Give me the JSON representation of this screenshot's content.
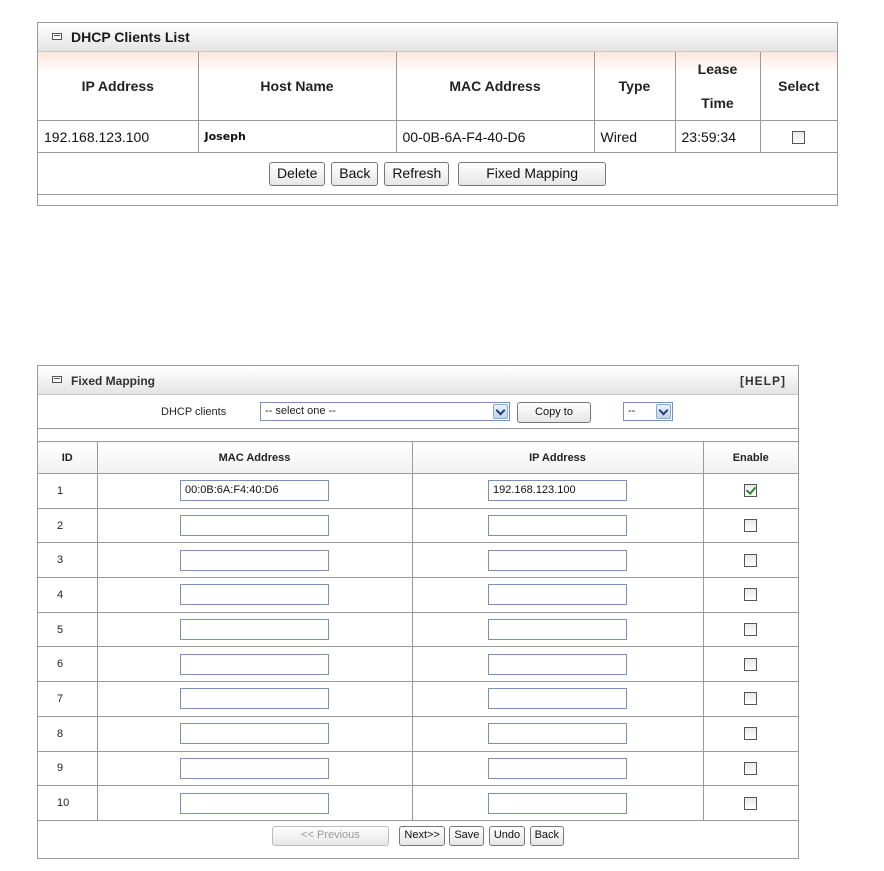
{
  "clients_panel": {
    "title": "DHCP Clients List",
    "columns": [
      "IP Address",
      "Host Name",
      "MAC Address",
      "Type",
      "Lease",
      "Time",
      "Select"
    ],
    "rows": [
      {
        "ip": "192.168.123.100",
        "host": "Joseph",
        "mac": "00-0B-6A-F4-40-D6",
        "type": "Wired",
        "lease": "23:59:34",
        "selected": false
      }
    ],
    "buttons": {
      "delete": "Delete",
      "back": "Back",
      "refresh": "Refresh",
      "fixed_mapping": "Fixed Mapping"
    }
  },
  "mapping_panel": {
    "title": "Fixed Mapping",
    "help": "[HELP]",
    "dhcp_clients_label": "DHCP clients",
    "dhcp_clients_select": "-- select one --",
    "copy_to_button": "Copy to",
    "copy_target_select": "--",
    "columns": {
      "id": "ID",
      "mac": "MAC Address",
      "ip": "IP Address",
      "enable": "Enable"
    },
    "rows": [
      {
        "id": "1",
        "mac": "00:0B:6A:F4:40:D6",
        "ip": "192.168.123.100",
        "enabled": true
      },
      {
        "id": "2",
        "mac": "",
        "ip": "",
        "enabled": false
      },
      {
        "id": "3",
        "mac": "",
        "ip": "",
        "enabled": false
      },
      {
        "id": "4",
        "mac": "",
        "ip": "",
        "enabled": false
      },
      {
        "id": "5",
        "mac": "",
        "ip": "",
        "enabled": false
      },
      {
        "id": "6",
        "mac": "",
        "ip": "",
        "enabled": false
      },
      {
        "id": "7",
        "mac": "",
        "ip": "",
        "enabled": false
      },
      {
        "id": "8",
        "mac": "",
        "ip": "",
        "enabled": false
      },
      {
        "id": "9",
        "mac": "",
        "ip": "",
        "enabled": false
      },
      {
        "id": "10",
        "mac": "",
        "ip": "",
        "enabled": false
      }
    ],
    "buttons": {
      "previous": "<< Previous",
      "next": "Next>>",
      "save": "Save",
      "undo": "Undo",
      "back": "Back"
    }
  },
  "icons": {
    "panel_icon": "window-icon",
    "select_arrow": "chevron-down-icon",
    "checkbox": "checkbox-icon"
  },
  "colors": {
    "border": "#9a9a9a",
    "check_mark": "#2a8a2a",
    "header_tint": "#fbe6dc"
  }
}
